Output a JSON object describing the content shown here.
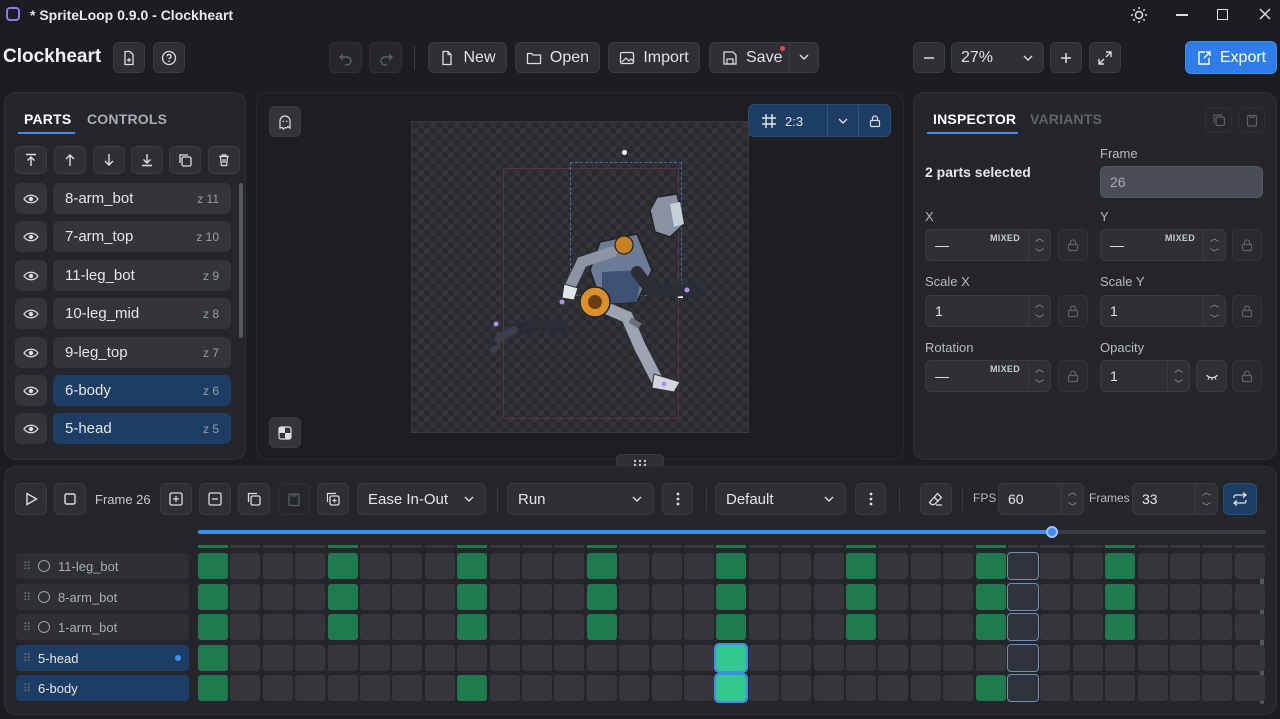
{
  "window": {
    "title": "* SpriteLoop 0.9.0 - Clockheart"
  },
  "toolbar": {
    "project_name": "Clockheart",
    "new_label": "New",
    "open_label": "Open",
    "import_label": "Import",
    "save_label": "Save",
    "zoom": "27%",
    "export_label": "Export"
  },
  "left_panel": {
    "tabs": [
      "PARTS",
      "CONTROLS"
    ],
    "active_tab": "PARTS",
    "parts": [
      {
        "name": "8-arm_bot",
        "z": "z 11",
        "selected": false
      },
      {
        "name": "7-arm_top",
        "z": "z 10",
        "selected": false
      },
      {
        "name": "11-leg_bot",
        "z": "z 9",
        "selected": false
      },
      {
        "name": "10-leg_mid",
        "z": "z 8",
        "selected": false
      },
      {
        "name": "9-leg_top",
        "z": "z 7",
        "selected": false
      },
      {
        "name": "6-body",
        "z": "z 6",
        "selected": true
      },
      {
        "name": "5-head",
        "z": "z 5",
        "selected": true
      }
    ]
  },
  "canvas": {
    "aspect_label": "2:3"
  },
  "inspector": {
    "tabs": [
      "INSPECTOR",
      "VARIANTS"
    ],
    "active_tab": "INSPECTOR",
    "selection_text": "2 parts selected",
    "frame_label": "Frame",
    "frame_value": "26",
    "fields": {
      "x": {
        "label": "X",
        "value": "—",
        "badge": "MIXED"
      },
      "y": {
        "label": "Y",
        "value": "—",
        "badge": "MIXED"
      },
      "scale_x": {
        "label": "Scale X",
        "value": "1"
      },
      "scale_y": {
        "label": "Scale Y",
        "value": "1"
      },
      "rotation": {
        "label": "Rotation",
        "value": "—",
        "badge": "MIXED"
      },
      "opacity": {
        "label": "Opacity",
        "value": "1"
      }
    }
  },
  "timeline": {
    "frame_label": "Frame 26",
    "easing": "Ease In-Out",
    "animation": "Run",
    "variant": "Default",
    "fps_label": "FPS",
    "fps": "60",
    "frames_label": "Frames",
    "frames": "33",
    "playhead_progress": 0.8,
    "track_names": [
      "11-leg_bot",
      "8-arm_bot",
      "1-arm_bot",
      "5-head",
      "6-body"
    ],
    "selected_tracks": [
      "5-head",
      "6-body"
    ],
    "visible_columns": 33,
    "current_column": 17,
    "playhead_column": 26,
    "keyframes": [
      [
        1,
        5,
        9,
        13,
        17,
        21,
        25,
        29
      ],
      [
        1,
        5,
        9,
        13,
        17,
        21,
        25,
        29
      ],
      [
        1,
        5,
        9,
        13,
        17,
        21,
        25,
        29
      ],
      [
        1,
        17
      ],
      [
        1,
        9,
        17,
        25
      ]
    ]
  },
  "colors": {
    "accent": "#2f7de8",
    "keyframe": "#1f7a4e",
    "current_keyframe": "#34c88f",
    "selected": "#1e3d64"
  }
}
